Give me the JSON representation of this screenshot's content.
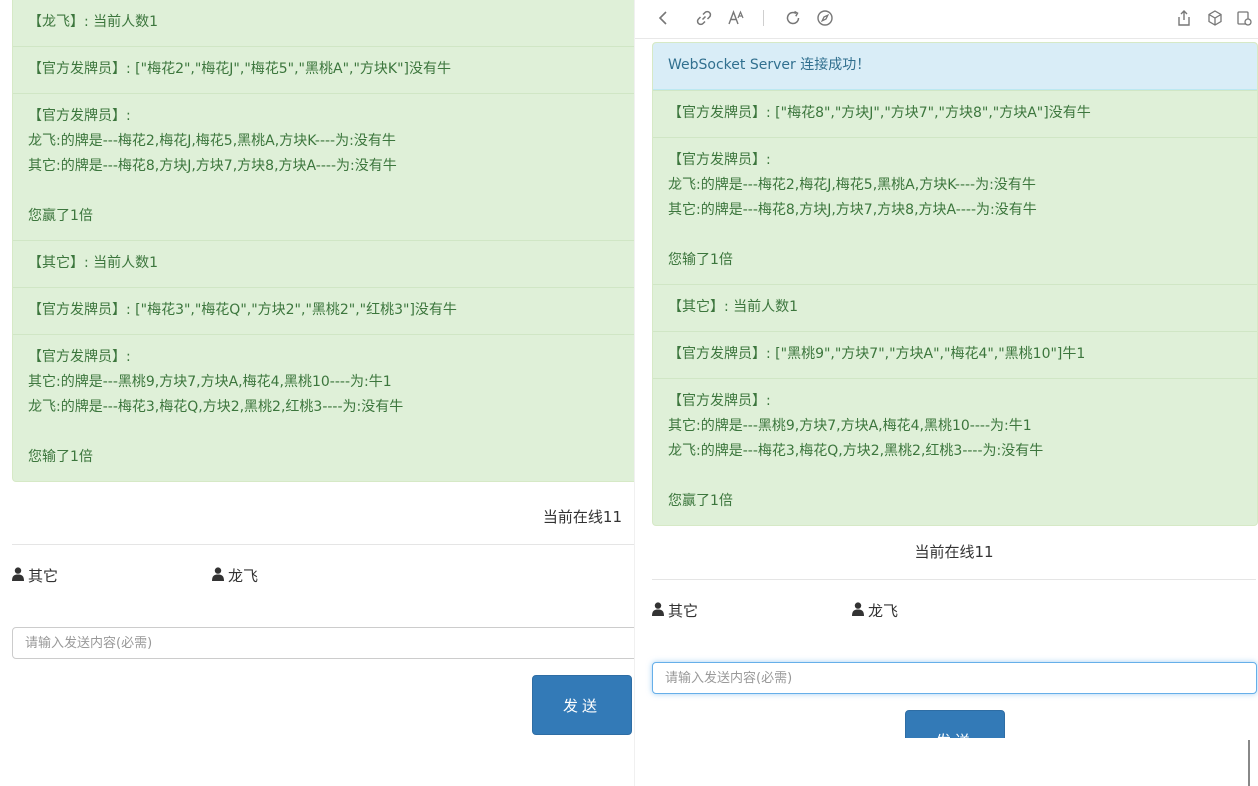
{
  "left": {
    "messages": [
      {
        "lines": [
          "【龙飞】: 当前人数1"
        ]
      },
      {
        "lines": [
          "【官方发牌员】: [\"梅花2\",\"梅花J\",\"梅花5\",\"黑桃A\",\"方块K\"]没有牛"
        ]
      },
      {
        "lines": [
          "【官方发牌员】:",
          "龙飞:的牌是---梅花2,梅花J,梅花5,黑桃A,方块K----为:没有牛",
          "其它:的牌是---梅花8,方块J,方块7,方块8,方块A----为:没有牛",
          "",
          "您赢了1倍"
        ]
      },
      {
        "lines": [
          "【其它】: 当前人数1"
        ]
      },
      {
        "lines": [
          "【官方发牌员】: [\"梅花3\",\"梅花Q\",\"方块2\",\"黑桃2\",\"红桃3\"]没有牛"
        ]
      },
      {
        "lines": [
          "【官方发牌员】:",
          "其它:的牌是---黑桃9,方块7,方块A,梅花4,黑桃10----为:牛1",
          "龙飞:的牌是---梅花3,梅花Q,方块2,黑桃2,红桃3----为:没有牛",
          "",
          "您输了1倍"
        ]
      }
    ],
    "online_label": "当前在线11",
    "users": [
      "其它",
      "龙飞"
    ],
    "input_placeholder": "请输入发送内容(必需)",
    "send_label": "发送"
  },
  "right": {
    "connection_status": "WebSocket Server 连接成功！",
    "messages": [
      {
        "lines": [
          "【官方发牌员】: [\"梅花8\",\"方块J\",\"方块7\",\"方块8\",\"方块A\"]没有牛"
        ]
      },
      {
        "lines": [
          "【官方发牌员】:",
          "龙飞:的牌是---梅花2,梅花J,梅花5,黑桃A,方块K----为:没有牛",
          "其它:的牌是---梅花8,方块J,方块7,方块8,方块A----为:没有牛",
          "",
          "您输了1倍"
        ]
      },
      {
        "lines": [
          "【其它】: 当前人数1"
        ]
      },
      {
        "lines": [
          "【官方发牌员】: [\"黑桃9\",\"方块7\",\"方块A\",\"梅花4\",\"黑桃10\"]牛1"
        ]
      },
      {
        "lines": [
          "【官方发牌员】:",
          "其它:的牌是---黑桃9,方块7,方块A,梅花4,黑桃10----为:牛1",
          "龙飞:的牌是---梅花3,梅花Q,方块2,黑桃2,红桃3----为:没有牛",
          "",
          "您赢了1倍"
        ]
      }
    ],
    "online_label": "当前在线11",
    "users": [
      "其它",
      "龙飞"
    ],
    "input_placeholder": "请输入发送内容(必需)",
    "send_label": "发送"
  },
  "toolbar_icons": [
    "back-icon",
    "link-icon",
    "font-size-icon",
    "reload-icon",
    "compass-icon",
    "share-icon",
    "cube-icon",
    "settings-icon"
  ],
  "colors": {
    "success_bg": "#dff0d8",
    "success_text": "#3c763d",
    "info_bg": "#d9edf7",
    "info_text": "#31708f",
    "primary": "#337ab7"
  }
}
